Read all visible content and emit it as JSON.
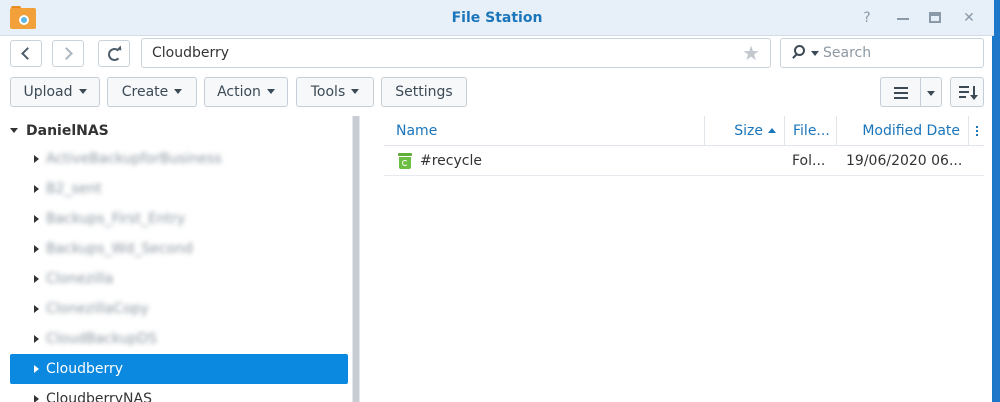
{
  "window": {
    "title": "File Station"
  },
  "nav": {
    "path": "Cloudberry",
    "search_placeholder": "Search"
  },
  "toolbar": {
    "upload": "Upload",
    "create": "Create",
    "action": "Action",
    "tools": "Tools",
    "settings": "Settings"
  },
  "tree": {
    "root": "DanielNAS",
    "items": [
      {
        "label": "ActiveBackupforBusiness",
        "blurred": true
      },
      {
        "label": "B2_sent",
        "blurred": true
      },
      {
        "label": "Backups_First_Entry",
        "blurred": true
      },
      {
        "label": "Backups_Wd_Second",
        "blurred": true
      },
      {
        "label": "Clonezilla",
        "blurred": true
      },
      {
        "label": "ClonezillaCopy",
        "blurred": true
      },
      {
        "label": "CloudBackupDS",
        "blurred": true
      },
      {
        "label": "Cloudberry",
        "selected": true
      },
      {
        "label": "CloudberryNAS"
      }
    ]
  },
  "filelist": {
    "columns": {
      "name": "Name",
      "size": "Size",
      "type": "File...",
      "modified": "Modified Date"
    },
    "rows": [
      {
        "name": "#recycle",
        "size": "",
        "type": "Fol...",
        "modified": "19/06/2020 06..."
      }
    ]
  },
  "colors": {
    "accent": "#1a75bb",
    "selection": "#0b88e0",
    "titlebar": "#e7f0f8"
  }
}
